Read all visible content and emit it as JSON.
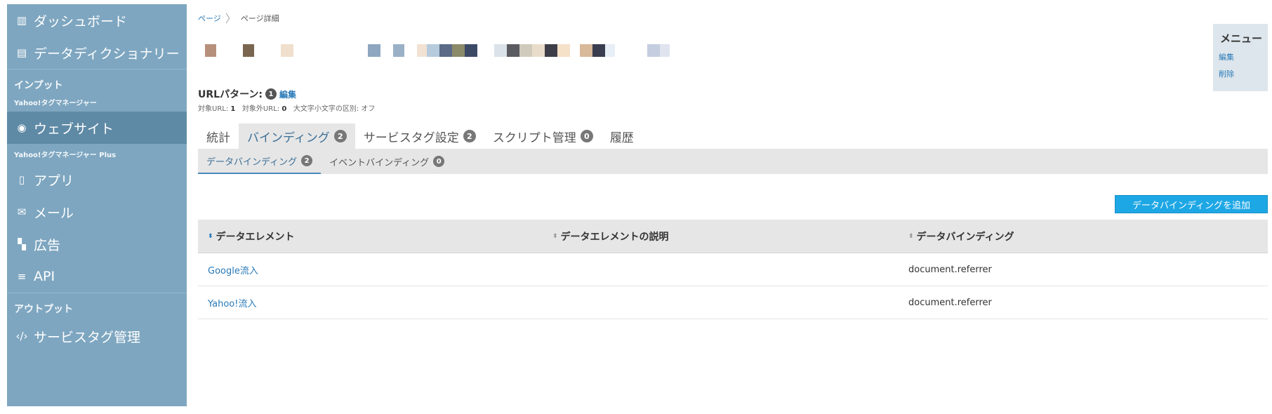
{
  "sidebar": {
    "top_items": [
      {
        "icon": "bar-chart-icon",
        "glyph": "▥",
        "label": "ダッシュボード"
      },
      {
        "icon": "book-icon",
        "glyph": "▤",
        "label": "データディクショナリー"
      }
    ],
    "input_section": "インプット",
    "ytm_label": "Yahoo!タグマネージャー",
    "website": {
      "icon": "globe-icon",
      "glyph": "◉",
      "label": "ウェブサイト"
    },
    "ytm_plus_label": "Yahoo!タグマネージャー Plus",
    "plus_items": [
      {
        "icon": "mobile-icon",
        "glyph": "▯",
        "label": "アプリ"
      },
      {
        "icon": "mail-icon",
        "glyph": "✉",
        "label": "メール"
      },
      {
        "icon": "ad-icon",
        "glyph": "▚",
        "label": "広告"
      },
      {
        "icon": "api-icon",
        "glyph": "≡",
        "label": "API"
      }
    ],
    "output_section": "アウトプット",
    "service_tag": {
      "icon": "code-icon",
      "glyph": "‹/›",
      "label": "サービスタグ管理"
    }
  },
  "breadcrumb": {
    "parent": "ページ",
    "current": "ページ詳細"
  },
  "menu": {
    "title": "メニュー",
    "edit": "編集",
    "delete": "削除"
  },
  "url_pattern": {
    "label": "URLパターン:",
    "count": "1",
    "edit": "編集",
    "target_label": "対象URL:",
    "target_value": "1",
    "excluded_label": "対象外URL:",
    "excluded_value": "0",
    "case_label": "大文字小文字の区別:",
    "case_value": "オフ"
  },
  "tabs": [
    {
      "label": "統計",
      "badge": ""
    },
    {
      "label": "バインディング",
      "badge": "2"
    },
    {
      "label": "サービスタグ設定",
      "badge": "2"
    },
    {
      "label": "スクリプト管理",
      "badge": "0"
    },
    {
      "label": "履歴",
      "badge": ""
    }
  ],
  "subtabs": [
    {
      "label": "データバインディング",
      "badge": "2"
    },
    {
      "label": "イベントバインディング",
      "badge": "0"
    }
  ],
  "add_button": "データバインディングを追加",
  "table": {
    "headers": [
      "データエレメント",
      "データエレメントの説明",
      "データバインディング"
    ],
    "rows": [
      [
        "Google流入",
        "",
        "document.referrer"
      ],
      [
        "Yahoo!流入",
        "",
        "document.referrer"
      ]
    ]
  },
  "colors": {
    "sidebar": "#7ea6c0",
    "accent": "#1ea7e5",
    "link": "#2a7ab8"
  }
}
